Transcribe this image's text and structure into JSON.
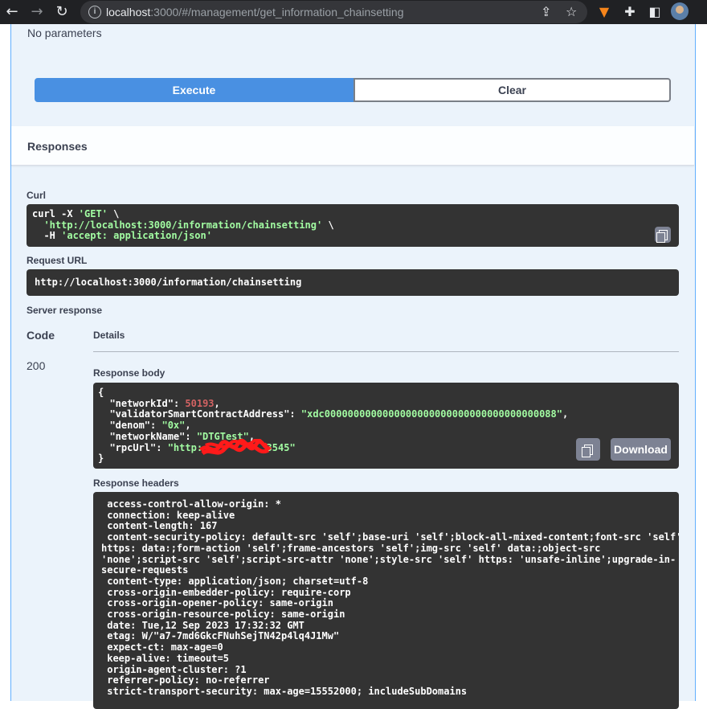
{
  "browser": {
    "url_host": "localhost",
    "url_rest": ":3000/#/management/get_information_chainsetting",
    "nav_icons": [
      "back-icon",
      "forward-icon",
      "reload-icon"
    ],
    "toolbar_icons": [
      "share-icon",
      "star-icon",
      "metamask-icon",
      "puzzle-icon",
      "sidepanel-icon",
      "profile-avatar"
    ]
  },
  "parameters": {
    "empty_text": "No parameters"
  },
  "actions": {
    "execute_label": "Execute",
    "clear_label": "Clear"
  },
  "responses": {
    "title": "Responses",
    "curl_label": "Curl",
    "curl": {
      "line1_cmd": "curl -X ",
      "line1_method": "'GET'",
      "line1_tail": " \\",
      "line2_url": "'http://localhost:3000/information/chainsetting'",
      "line2_tail": " \\",
      "line3_flag": "  -H ",
      "line3_header": "'accept: application/json'"
    },
    "request_url_label": "Request URL",
    "request_url": "http://localhost:3000/information/chainsetting",
    "server_response_label": "Server response",
    "col_code": "Code",
    "col_details": "Details",
    "status_code": "200",
    "body_label": "Response body",
    "body": {
      "networkId_key": "\"networkId\"",
      "networkId_val": "50193",
      "validator_key": "\"validatorSmartContractAddress\"",
      "validator_val": "\"xdc0000000000000000000000000000000000000088\"",
      "denom_key": "\"denom\"",
      "denom_val": "\"0x\"",
      "networkName_key": "\"networkName\"",
      "networkName_val": "\"DTGTest\"",
      "rpcUrl_key": "\"rpcUrl\"",
      "rpcUrl_val_start": "\"http:",
      "rpcUrl_val_end": "3545\""
    },
    "download_label": "Download",
    "headers_label": "Response headers",
    "headers_lines": [
      " access-control-allow-origin: * ",
      " connection: keep-alive ",
      " content-length: 167 ",
      " content-security-policy: default-src 'self';base-uri 'self';block-all-mixed-content;font-src 'self'",
      "https: data:;form-action 'self';frame-ancestors 'self';img-src 'self' data:;object-src",
      "'none';script-src 'self';script-src-attr 'none';style-src 'self' https: 'unsafe-inline';upgrade-in-",
      "secure-requests ",
      " content-type: application/json; charset=utf-8 ",
      " cross-origin-embedder-policy: require-corp ",
      " cross-origin-opener-policy: same-origin ",
      " cross-origin-resource-policy: same-origin ",
      " date: Tue,12 Sep 2023 17:32:32 GMT ",
      " etag: W/\"a7-7md6GkcFNuhSejTN42p4lq4J1Mw\" ",
      " expect-ct: max-age=0 ",
      " keep-alive: timeout=5 ",
      " origin-agent-cluster: ?1 ",
      " referrer-policy: no-referrer ",
      " strict-transport-security: max-age=15552000; includeSubDomains "
    ]
  }
}
